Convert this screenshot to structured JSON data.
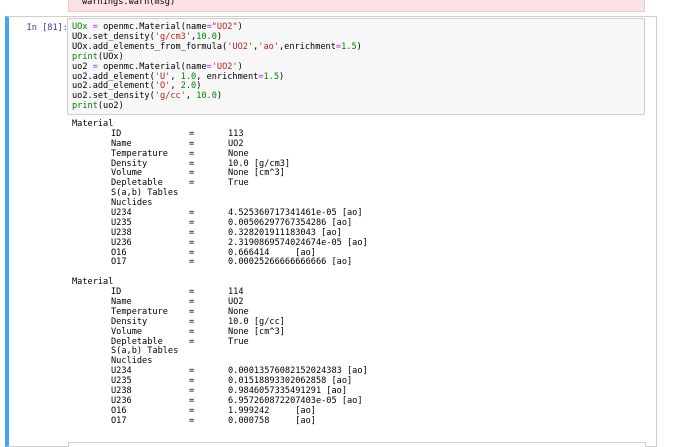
{
  "warning": {
    "text": "warnings.warn(msg)"
  },
  "cell": {
    "prompt": "In [81]:",
    "code_lines": [
      "UOx = openmc.Material(name=\"UO2\")",
      "UOx.set_density('g/cm3',10.0)",
      "UOx.add_elements_from_formula('UO2','ao',enrichment=1.5)",
      "print(UOx)",
      "uo2 = openmc.Material(name='UO2')",
      "uo2.add_element('U', 1.0, enrichment=1.5)",
      "uo2.add_element('O', 2.0)",
      "uo2.set_density('g/cc', 10.0)",
      "print(uo2)"
    ]
  },
  "output": {
    "materials": [
      {
        "header": "Material",
        "props": [
          {
            "key": "ID",
            "eq": "=",
            "value": "113"
          },
          {
            "key": "Name",
            "eq": "=",
            "value": "UO2"
          },
          {
            "key": "Temperature",
            "eq": "=",
            "value": "None"
          },
          {
            "key": "Density",
            "eq": "=",
            "value": "10.0 [g/cm3]"
          },
          {
            "key": "Volume",
            "eq": "=",
            "value": "None [cm^3]"
          },
          {
            "key": "Depletable",
            "eq": "=",
            "value": "True"
          }
        ],
        "sab_label": "S(a,b) Tables",
        "nuclides_label": "Nuclides",
        "nuclides": [
          {
            "key": "U234",
            "eq": "=",
            "value": "4.525360717341461e-05 [ao]"
          },
          {
            "key": "U235",
            "eq": "=",
            "value": "0.00506297767354286 [ao]"
          },
          {
            "key": "U238",
            "eq": "=",
            "value": "0.328201911183043 [ao]"
          },
          {
            "key": "U236",
            "eq": "=",
            "value": "2.3190869574024674e-05 [ao]"
          },
          {
            "key": "O16",
            "eq": "=",
            "value": "0.666414     [ao]"
          },
          {
            "key": "O17",
            "eq": "=",
            "value": "0.00025266666666666 [ao]"
          }
        ]
      },
      {
        "header": "Material",
        "props": [
          {
            "key": "ID",
            "eq": "=",
            "value": "114"
          },
          {
            "key": "Name",
            "eq": "=",
            "value": "UO2"
          },
          {
            "key": "Temperature",
            "eq": "=",
            "value": "None"
          },
          {
            "key": "Density",
            "eq": "=",
            "value": "10.0 [g/cc]"
          },
          {
            "key": "Volume",
            "eq": "=",
            "value": "None [cm^3]"
          },
          {
            "key": "Depletable",
            "eq": "=",
            "value": "True"
          }
        ],
        "sab_label": "S(a,b) Tables",
        "nuclides_label": "Nuclides",
        "nuclides": [
          {
            "key": "U234",
            "eq": "=",
            "value": "0.00013576082152024383 [ao]"
          },
          {
            "key": "U235",
            "eq": "=",
            "value": "0.01518893302062858 [ao]"
          },
          {
            "key": "U238",
            "eq": "=",
            "value": "0.9846057335491291 [ao]"
          },
          {
            "key": "U236",
            "eq": "=",
            "value": "6.957260872207403e-05 [ao]"
          },
          {
            "key": "O16",
            "eq": "=",
            "value": "1.999242     [ao]"
          },
          {
            "key": "O17",
            "eq": "=",
            "value": "0.000758     [ao]"
          }
        ]
      }
    ]
  }
}
